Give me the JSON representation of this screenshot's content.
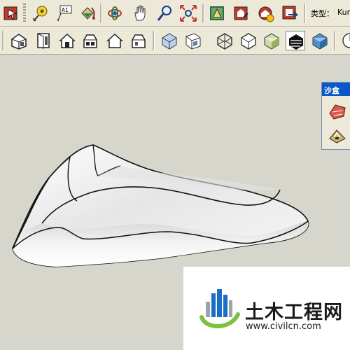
{
  "toolbar_top": {
    "buttons": [
      {
        "name": "select-icon"
      },
      {
        "name": "tape-measure-icon"
      },
      {
        "name": "text-icon",
        "label": "A1"
      },
      {
        "name": "paint-bucket-icon"
      },
      {
        "name": "orbit-icon"
      },
      {
        "name": "pan-hand-icon"
      },
      {
        "name": "zoom-icon"
      },
      {
        "name": "zoom-extents-icon"
      },
      {
        "name": "previous-view-icon"
      },
      {
        "name": "get-models-icon"
      },
      {
        "name": "share-model-icon"
      },
      {
        "name": "send-to-layout-icon"
      }
    ],
    "type_label": "类型：",
    "type_value": "Kune"
  },
  "toolbar_views": {
    "buttons": [
      {
        "name": "iso-view-icon"
      },
      {
        "name": "top-view-icon"
      },
      {
        "name": "front-view-icon"
      },
      {
        "name": "right-view-icon"
      },
      {
        "name": "back-view-icon"
      },
      {
        "name": "left-view-icon"
      },
      {
        "name": "xray-style-icon"
      },
      {
        "name": "wireframe-style-icon"
      },
      {
        "name": "hidden-line-style-icon"
      },
      {
        "name": "shaded-style-icon"
      },
      {
        "name": "shaded-textures-style-icon"
      },
      {
        "name": "monochrome-style-icon",
        "active": true
      },
      {
        "name": "extra-style-icon"
      }
    ]
  },
  "sandbox_panel": {
    "title": "沙盒",
    "tools": [
      {
        "name": "sandbox-from-contours-icon"
      },
      {
        "name": "sandbox-smoove-icon"
      }
    ]
  },
  "watermark": {
    "text": "土木工程网",
    "url": "www.civilcn.com",
    "colors": {
      "blue": "#1a6fc4",
      "green": "#7cc242",
      "gray": "#9aa4ae"
    }
  }
}
